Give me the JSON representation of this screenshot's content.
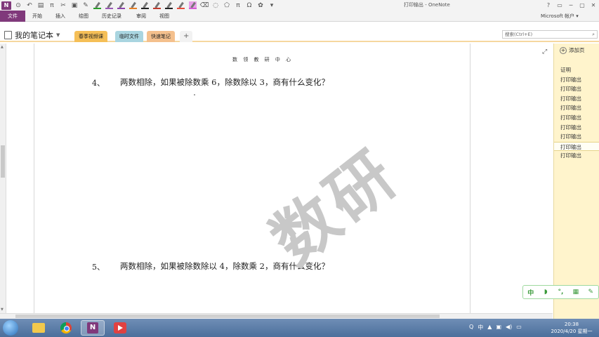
{
  "window": {
    "title": "打印输出 - OneNote",
    "account": "Microsoft 帐户 ▾",
    "controls": [
      "?",
      "▭",
      "─",
      "▢",
      "✕"
    ]
  },
  "ribbon": {
    "file_tab": "文件",
    "tabs": [
      "开始",
      "插入",
      "绘图",
      "历史记录",
      "审阅",
      "视图"
    ]
  },
  "notebook": {
    "name": "我的笔记本",
    "sections": [
      "春季视频课",
      "临时文件",
      "快速笔记"
    ],
    "add_section": "+"
  },
  "search": {
    "placeholder": "搜索(Ctrl+E)"
  },
  "page": {
    "header": "数 领 教 研 中 心",
    "questions": [
      {
        "num": "4、",
        "text": "两数相除，如果被除数乘 6，除数除以 3，商有什么变化？"
      },
      {
        "num": "5、",
        "text": "两数相除，如果被除数除以 4，除数乘 2，商有什么变化？"
      }
    ],
    "watermark": "数研"
  },
  "page_panel": {
    "add_page": "添加页",
    "items": [
      "证明",
      "打印输出",
      "打印输出",
      "打印输出",
      "打印输出",
      "打印输出",
      "打印输出",
      "打印输出",
      "打印输出",
      "打印输出"
    ],
    "selected_index": 8
  },
  "ime": {
    "buttons": [
      "中",
      "◗",
      "°,",
      "▦",
      "✎"
    ]
  },
  "taskbar": {
    "tray": [
      "Q",
      "中",
      "▲",
      "▣",
      "◀)",
      "▭"
    ],
    "time": "20:38",
    "date": "2020/4/20 星期一"
  },
  "colors": {
    "onenote_purple": "#80397b",
    "active_section": "#f5bf57",
    "page_panel_bg": "#fff4cc"
  }
}
